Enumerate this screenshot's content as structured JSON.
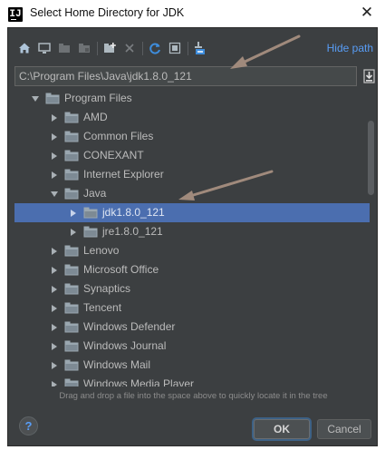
{
  "window": {
    "title": "Select Home Directory for JDK",
    "app_icon_letter": "IJ"
  },
  "toolbar": {
    "icons": [
      "home-icon",
      "desktop-icon",
      "project-icon",
      "module-icon",
      "new-folder-icon",
      "delete-icon",
      "refresh-icon",
      "show-hidden-icon",
      "collapse-all-icon"
    ],
    "hide_path_label": "Hide path"
  },
  "path": {
    "value": "C:\\Program Files\\Java\\jdk1.8.0_121"
  },
  "tree": {
    "rows": [
      {
        "label": "Program Files",
        "expanded": true,
        "selected": false
      },
      {
        "label": "AMD",
        "expanded": false,
        "selected": false
      },
      {
        "label": "Common Files",
        "expanded": false,
        "selected": false
      },
      {
        "label": "CONEXANT",
        "expanded": false,
        "selected": false
      },
      {
        "label": "Internet Explorer",
        "expanded": false,
        "selected": false
      },
      {
        "label": "Java",
        "expanded": true,
        "selected": false
      },
      {
        "label": "jdk1.8.0_121",
        "expanded": false,
        "selected": true
      },
      {
        "label": "jre1.8.0_121",
        "expanded": false,
        "selected": false
      },
      {
        "label": "Lenovo",
        "expanded": false,
        "selected": false
      },
      {
        "label": "Microsoft Office",
        "expanded": false,
        "selected": false
      },
      {
        "label": "Synaptics",
        "expanded": false,
        "selected": false
      },
      {
        "label": "Tencent",
        "expanded": false,
        "selected": false
      },
      {
        "label": "Windows Defender",
        "expanded": false,
        "selected": false
      },
      {
        "label": "Windows Journal",
        "expanded": false,
        "selected": false
      },
      {
        "label": "Windows Mail",
        "expanded": false,
        "selected": false
      },
      {
        "label": "Windows Media Player",
        "expanded": false,
        "selected": false
      }
    ]
  },
  "footer": {
    "hint": "Drag and drop a file into the space above to quickly locate it in the tree",
    "help_label": "?",
    "ok_label": "OK",
    "cancel_label": "Cancel"
  },
  "colors": {
    "background": "#3c3f41",
    "selection": "#4b6eaf",
    "link": "#589df6",
    "folder": "#9aa7b0",
    "annotation_arrow": "#a08a7c"
  }
}
